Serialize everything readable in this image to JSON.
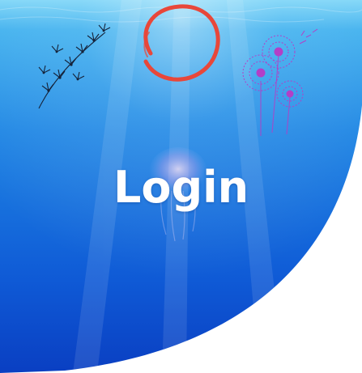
{
  "login": {
    "title": "Login"
  },
  "colors": {
    "ocean_top": "#5fc4f0",
    "ocean_mid": "#1f8ee6",
    "ocean_deep": "#0a3fc7",
    "ring": "#e8473a",
    "dandelion_left": "#1a1a2e",
    "dandelion_right": "#b33fc7",
    "title": "#ffffff",
    "background": "#ffffff"
  },
  "decorations": {
    "ring_icon": "hand-drawn-circle",
    "left_icon": "dandelion-seeds",
    "right_icon": "dandelion-flowers",
    "center_icon": "jellyfish"
  }
}
